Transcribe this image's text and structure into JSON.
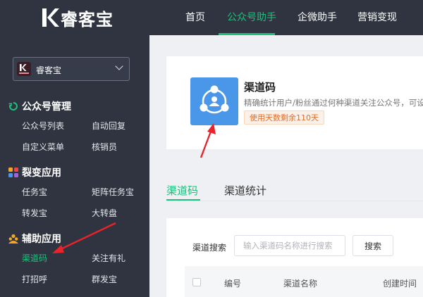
{
  "header": {
    "logo_text": "睿客宝",
    "nav": [
      "首页",
      "公众号助手",
      "企微助手",
      "营销变现"
    ],
    "active_nav": "公众号助手"
  },
  "sidebar": {
    "account": {
      "name": "睿客宝",
      "avatar_text": "睿客宝"
    },
    "groups": [
      {
        "title": "公众号管理",
        "icon": "refresh-icon",
        "items": [
          "公众号列表",
          "自动回复",
          "自定义菜单",
          "核销员"
        ]
      },
      {
        "title": "裂变应用",
        "icon": "apps-icon",
        "items": [
          "任务宝",
          "矩阵任务宝",
          "转发宝",
          "大转盘"
        ]
      },
      {
        "title": "辅助应用",
        "icon": "people-icon",
        "items": [
          "渠道码",
          "关注有礼",
          "打招呼",
          "群发宝"
        ]
      }
    ],
    "active_item": "渠道码"
  },
  "feature": {
    "title": "渠道码",
    "description": "精确统计用户/粉丝通过何种渠道关注公众号，可设",
    "badge": "使用天数剩余110天",
    "icon": "share-people-icon",
    "icon_color": "#4a96e8"
  },
  "tabs": [
    "渠道码",
    "渠道统计"
  ],
  "active_tab": "渠道码",
  "search": {
    "label": "渠道搜索",
    "placeholder": "输入渠道码名称进行搜索",
    "button": "搜索"
  },
  "table": {
    "columns": [
      "编号",
      "渠道名称",
      "创建时间"
    ]
  },
  "colors": {
    "accent": "#1ec07a",
    "sidebar_bg": "#2f3440",
    "annotation": "#e8242a"
  }
}
